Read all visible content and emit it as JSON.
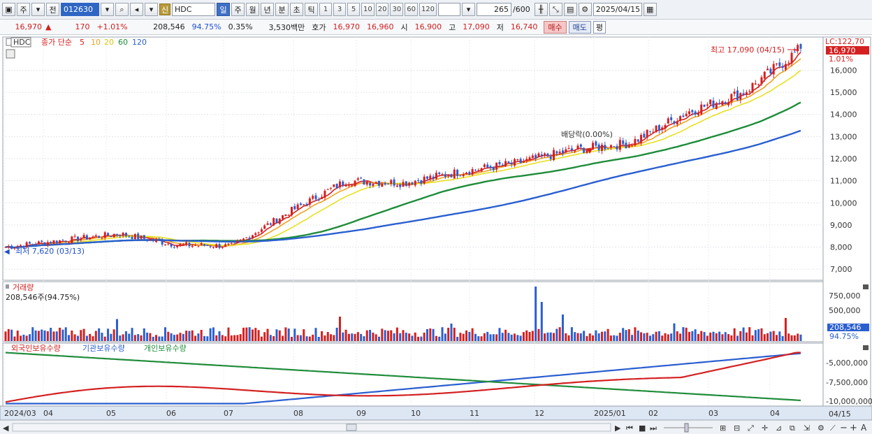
{
  "toolbar": {
    "type_label": "주",
    "prev_label": "전",
    "stock_code": "012630",
    "new_badge": "신",
    "stock_name": "HDC",
    "periods": [
      "일",
      "주",
      "월",
      "년",
      "분",
      "초",
      "틱"
    ],
    "active_period": "일",
    "intervals": [
      "1",
      "3",
      "5",
      "10",
      "20",
      "30",
      "60",
      "120"
    ],
    "count_value": "265",
    "count_max": "/600",
    "date": "2025/04/15"
  },
  "quote": {
    "price": "16,970",
    "change": "170",
    "change_pct": "+1.01%",
    "volume": "208,546",
    "volume_ratio": "94.75%",
    "turnover": "0.35%",
    "amount": "3,530백만",
    "bid_label": "호가",
    "ask_price": "16,970",
    "bid_price": "16,960",
    "open_label": "시",
    "open": "16,900",
    "high_label": "고",
    "high": "17,090",
    "low_label": "저",
    "low": "16,740",
    "buy_label": "매수",
    "sell_label": "매도",
    "ping_label": "평"
  },
  "price_panel": {
    "ticker": "HDC",
    "legend_title": "종가 단순",
    "ma_periods": [
      "5",
      "10",
      "20",
      "60",
      "120"
    ],
    "ma_colors": [
      "#d42020",
      "#f0a020",
      "#e8e020",
      "#1e8c3a",
      "#2a5fd0"
    ],
    "lc_label": "LC:122,70",
    "current_price_tag": "16,970",
    "pct_tag": "1.01%",
    "high_annotation": "최고 17,090 (04/15)",
    "low_annotation": "최저 7,620 (03/13)",
    "dividend_annotation": "배당락(0.00%)",
    "y_ticks": [
      "16,000",
      "15,000",
      "14,000",
      "13,000",
      "12,000",
      "11,000",
      "10,000",
      "9,000",
      "8,000",
      "7,000"
    ]
  },
  "volume_panel": {
    "title": "거래량",
    "value_label": "208,546주(94.75%)",
    "y_ticks": [
      "750,000",
      "500,000"
    ],
    "current_tag": "208,546",
    "pct_tag": "94.75%"
  },
  "holdings_panel": {
    "legend": [
      "외국인보유수량",
      "기관보유수량",
      "개인보유수량"
    ],
    "legend_colors": [
      "#d42020",
      "#2a5fd0",
      "#1e8c3a"
    ],
    "y_ticks": [
      "-5,000,000",
      "-7,500,000",
      "-10,000,000"
    ]
  },
  "x_axis": {
    "labels": [
      "2024/03",
      "04",
      "05",
      "06",
      "07",
      "08",
      "09",
      "10",
      "11",
      "12",
      "2025/01",
      "02",
      "03",
      "04"
    ],
    "right_label": "04/15"
  },
  "chart_data": {
    "type": "line",
    "title": "",
    "x": [
      "2024/03",
      "04",
      "05",
      "06",
      "07",
      "08",
      "09",
      "10",
      "11",
      "12",
      "2025/01",
      "02",
      "03",
      "04",
      "04/15"
    ],
    "series": [
      {
        "name": "",
        "values": [
          8000,
          8300,
          8600,
          8100,
          8050,
          9600,
          11000,
          10900,
          11400,
          11800,
          12400,
          12700,
          14100,
          15000,
          16970
        ]
      }
    ],
    "ylim": [
      6500,
      17500
    ],
    "high": 17090,
    "low": 7620
  }
}
